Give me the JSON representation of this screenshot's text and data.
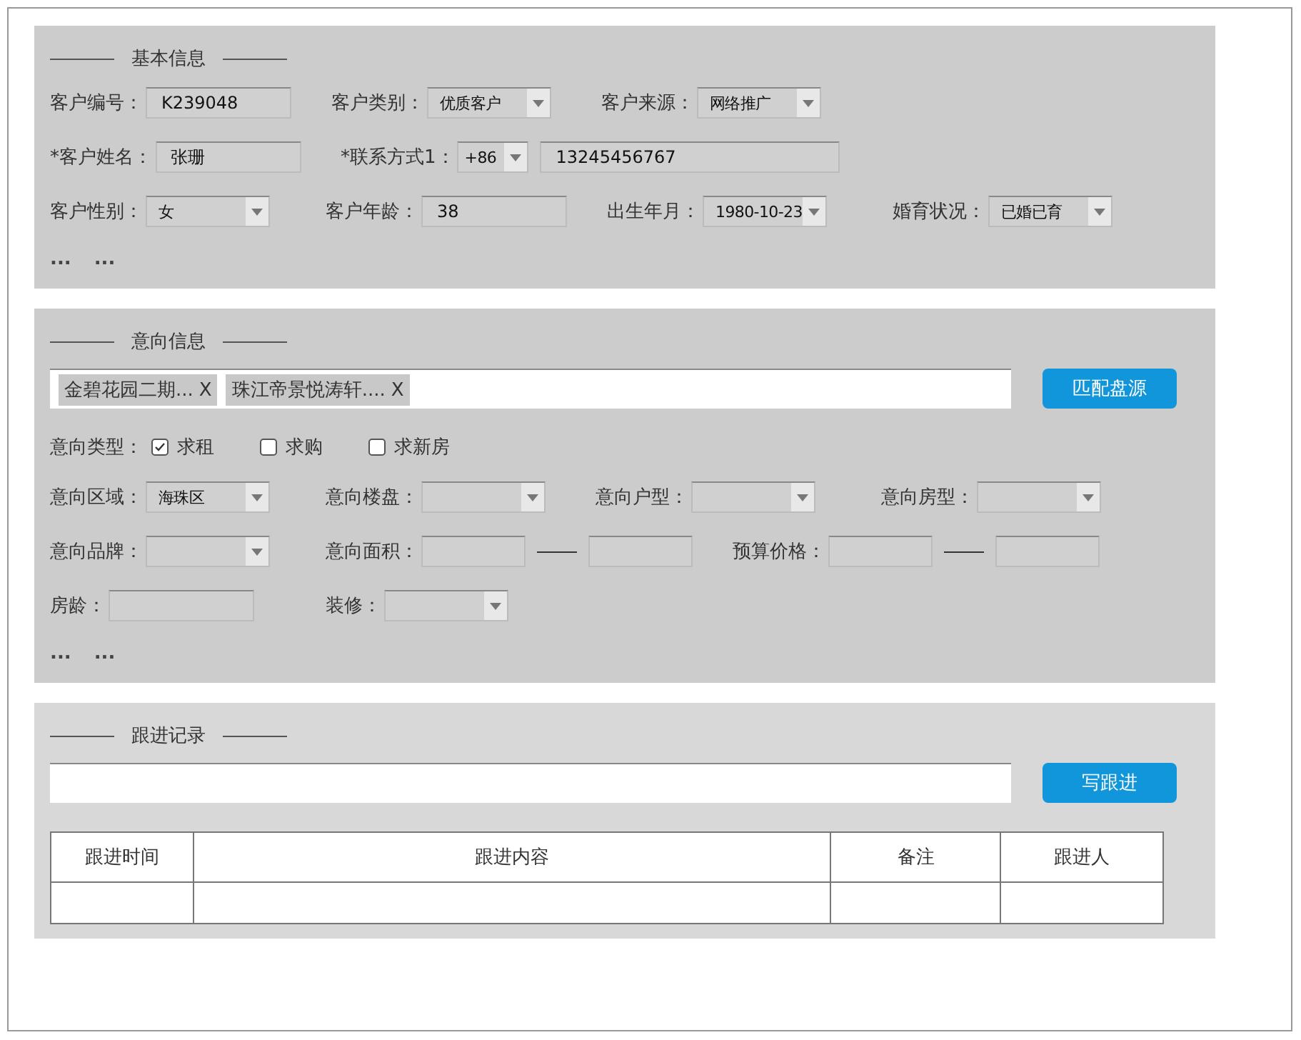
{
  "basic_info": {
    "title": "基本信息",
    "rows": [
      [
        {
          "label": "客户编号：",
          "kind": "text",
          "value": "K239048"
        },
        {
          "label": "客户类别：",
          "kind": "select",
          "value": "优质客户"
        },
        {
          "label": "客户来源：",
          "kind": "select",
          "value": "网络推广"
        }
      ],
      [
        {
          "label": "*客户姓名：",
          "kind": "text",
          "value": "张珊"
        },
        {
          "label": "*联系方式1：",
          "kind": "phone",
          "prefix": "+86",
          "value": "13245456767"
        }
      ],
      [
        {
          "label": "客户性别：",
          "kind": "select",
          "value": "女"
        },
        {
          "label": "客户年龄：",
          "kind": "text",
          "value": "38"
        },
        {
          "label": "出生年月：",
          "kind": "select",
          "value": "1980-10-23"
        },
        {
          "label": "婚育状况：",
          "kind": "select",
          "value": "已婚已育"
        }
      ]
    ],
    "more": [
      "...",
      "..."
    ]
  },
  "intent_info": {
    "title": "意向信息",
    "tags": [
      {
        "text": "金碧花园二期...",
        "remove": "X"
      },
      {
        "text": "珠江帝景悦涛轩....",
        "remove": "X"
      }
    ],
    "match_button": "匹配盘源",
    "intent_type": {
      "label": "意向类型：",
      "options": [
        {
          "label": "求租",
          "checked": true
        },
        {
          "label": "求购",
          "checked": false
        },
        {
          "label": "求新房",
          "checked": false
        }
      ]
    },
    "rows": [
      [
        {
          "label": "意向区域：",
          "kind": "select",
          "value": "海珠区"
        },
        {
          "label": "意向楼盘：",
          "kind": "select"
        },
        {
          "label": "意向户型：",
          "kind": "select"
        },
        {
          "label": "意向房型：",
          "kind": "select"
        }
      ],
      [
        {
          "label": "意向品牌：",
          "kind": "select"
        },
        {
          "label": "意向面积：",
          "kind": "range"
        },
        {
          "label": "预算价格：",
          "kind": "range"
        }
      ],
      [
        {
          "label": "房龄：",
          "kind": "text"
        },
        {
          "label": "装修：",
          "kind": "select"
        }
      ]
    ],
    "more": [
      "...",
      "..."
    ]
  },
  "follow_up": {
    "title": "跟进记录",
    "button": "写跟进",
    "table": {
      "columns": [
        "跟进时间",
        "跟进内容",
        "备注",
        "跟进人"
      ]
    }
  }
}
